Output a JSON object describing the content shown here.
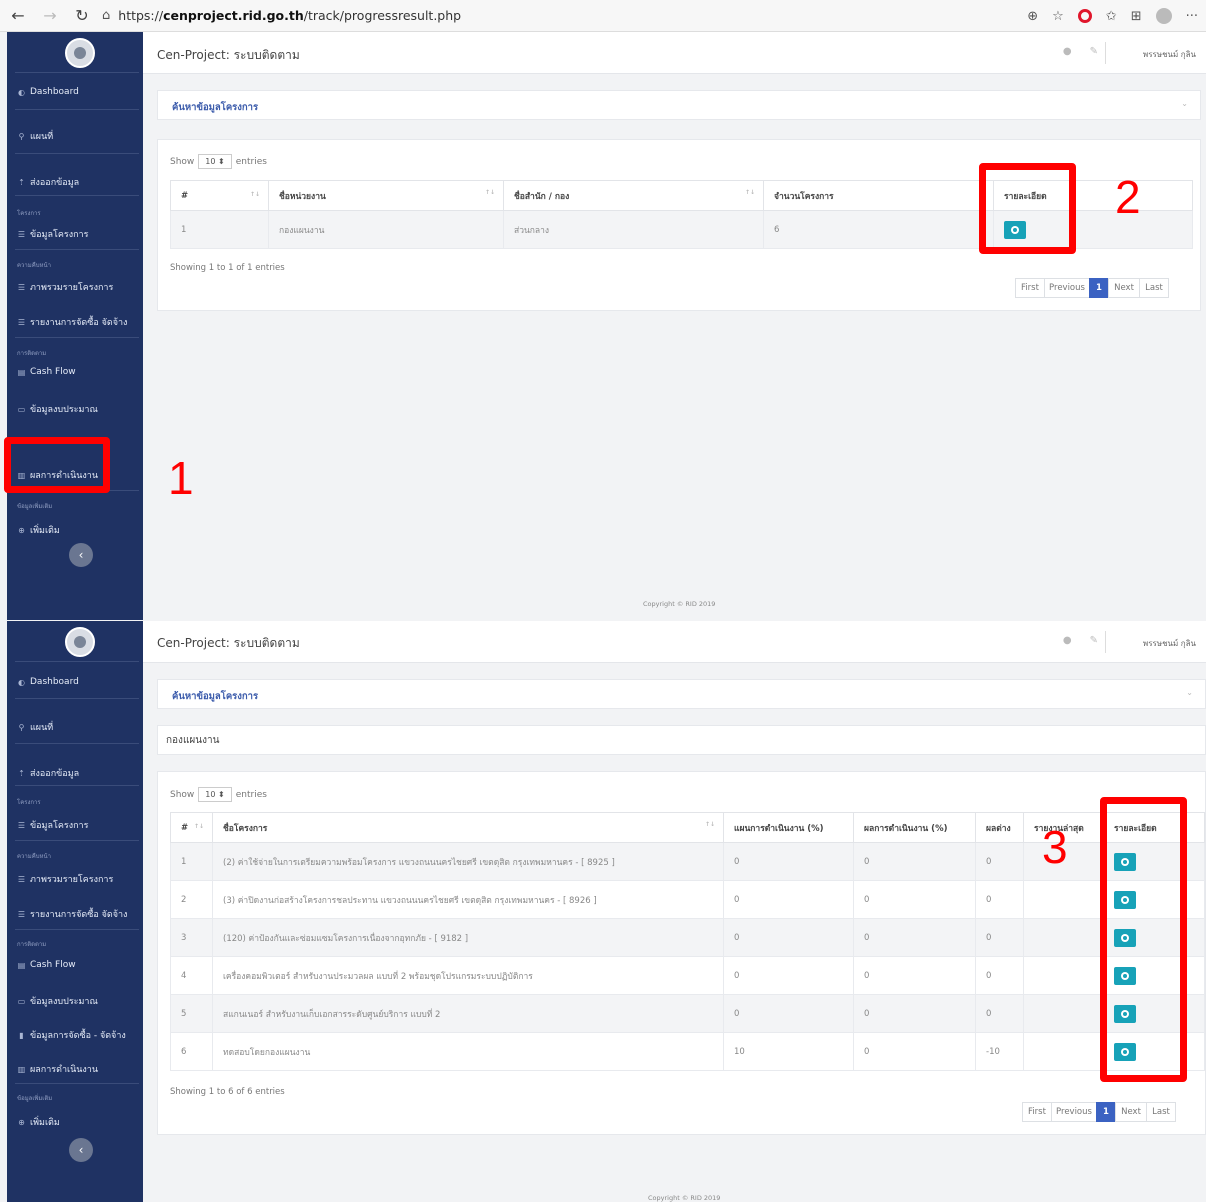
{
  "browser": {
    "back": "←",
    "forward": "→",
    "reload": "↻",
    "lock": "⌂",
    "url_prefix": "https://",
    "url_domain": "cenproject.rid.go.th",
    "url_path": "/track/progressresult.php",
    "zoom_icon": "⊕",
    "star": "☆",
    "fav_icon": "✩",
    "collections_icon": "⊞",
    "more": "···"
  },
  "app": {
    "title": "Cen-Project: ระบบติดตาม",
    "info_icon": "●",
    "wrench_icon": "✎",
    "user": "พรรษชนม์ กุลิน",
    "search_title": "ค้นหาข้อมูลโครงการ",
    "chevron": "⌄",
    "copyright": "Copyright © RID 2019"
  },
  "sidebar": {
    "dashboard": "Dashboard",
    "map": "แผนที่",
    "export": "ส่งออกข้อมูล",
    "section_project": "โครงการ",
    "project_data": "ข้อมูลโครงการ",
    "section_report": "ความคืบหน้า",
    "overview": "ภาพรวมรายโครงการ",
    "procurement_report": "รายงานการจัดซื้อ จัดจ้าง",
    "section_follow": "การติดตาม",
    "cashflow": "Cash Flow",
    "budget": "ข้อมูลงบประมาณ",
    "procurement_data": "ข้อมูลการจัดซื้อ - จัดจ้าง",
    "results": "ผลการดำเนินงาน",
    "section_extra": "ข้อมูลเพิ่มเติม",
    "more": "เพิ่มเติม",
    "collapse": "‹"
  },
  "table1": {
    "show_label": "Show",
    "page_size": "10 ⬍",
    "entries_label": "entries",
    "headers": [
      "#",
      "ชื่อหน่วยงาน",
      "ชื่อสำนัก / กอง",
      "จำนวนโครงการ",
      "รายละเอียด"
    ],
    "rows": [
      [
        "1",
        "กองแผนงาน",
        "ส่วนกลาง",
        "6"
      ]
    ],
    "info": "Showing 1 to 1 of 1 entries",
    "pager": [
      "First",
      "Previous",
      "1",
      "Next",
      "Last"
    ]
  },
  "department": "กองแผนงาน",
  "table2": {
    "show_label": "Show",
    "page_size": "10 ⬍",
    "entries_label": "entries",
    "headers": [
      "#",
      "ชื่อโครงการ",
      "แผนการดำเนินงาน (%)",
      "ผลการดำเนินงาน (%)",
      "ผลต่าง",
      "รายงานล่าสุด",
      "รายละเอียด"
    ],
    "rows": [
      [
        "1",
        "(2) ค่าใช้จ่ายในการเตรียมความพร้อมโครงการ แขวงถนนนครไชยศรี เขตดุสิต กรุงเทพมหานคร - [ 8925 ]",
        "0",
        "0",
        "0",
        ""
      ],
      [
        "2",
        "(3) ค่าปิดงานก่อสร้างโครงการชลประทาน แขวงถนนนครไชยศรี เขตดุสิต กรุงเทพมหานคร - [ 8926 ]",
        "0",
        "0",
        "0",
        ""
      ],
      [
        "3",
        "(120) ค่าป้องกันและซ่อมแซมโครงการเนื่องจากอุทกภัย - [ 9182 ]",
        "0",
        "0",
        "0",
        ""
      ],
      [
        "4",
        "เครื่องคอมพิวเตอร์ สำหรับงานประมวลผล แบบที่ 2 พร้อมชุดโปรแกรมระบบปฏิบัติการ",
        "0",
        "0",
        "0",
        ""
      ],
      [
        "5",
        "สแกนเนอร์ สำหรับงานเก็บเอกสารระดับศูนย์บริการ แบบที่ 2",
        "0",
        "0",
        "0",
        ""
      ],
      [
        "6",
        "ทดสอบโดยกองแผนงาน",
        "10",
        "0",
        "-10",
        ""
      ]
    ],
    "info": "Showing 1 to 6 of 6 entries",
    "pager": [
      "First",
      "Previous",
      "1",
      "Next",
      "Last"
    ]
  },
  "annotations": {
    "n1": "1",
    "n2": "2",
    "n3": "3",
    "color": "#ff0000"
  }
}
